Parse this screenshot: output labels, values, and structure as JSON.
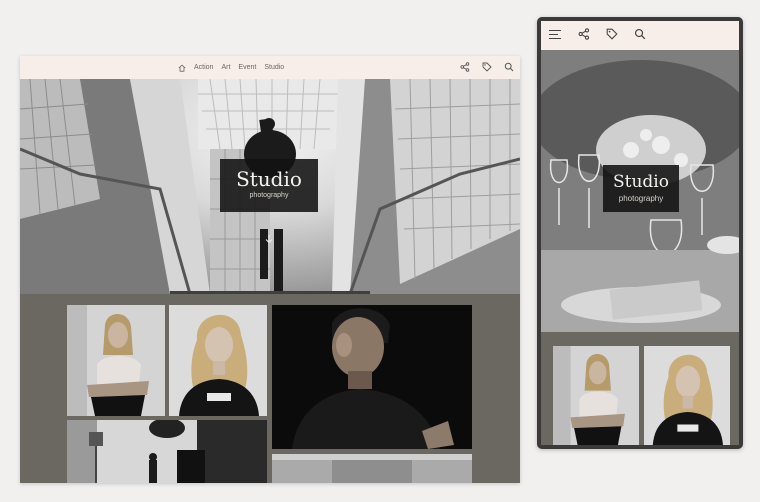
{
  "desktop": {
    "nav": {
      "links": [
        "Action",
        "Art",
        "Event",
        "Studio"
      ]
    },
    "hero": {
      "title": "Studio",
      "subtitle": "photography"
    }
  },
  "mobile": {
    "hero": {
      "title": "Studio",
      "subtitle": "photography"
    }
  },
  "icons": [
    "home-icon",
    "share-icon",
    "tag-icon",
    "search-icon",
    "menu-icon",
    "arrow-down-icon"
  ],
  "colors": {
    "nav_bg": "#f7eeea",
    "page_bg": "#f1f0ef",
    "gallery_bg": "#6b6862",
    "title_box": "#121212",
    "phone_frame": "#3a3a3a"
  }
}
